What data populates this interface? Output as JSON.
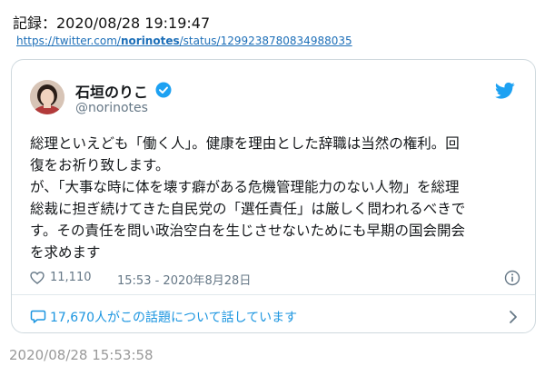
{
  "record": {
    "label": "記録：2020/08/28 19:19:47",
    "link_prefix": "https://twitter.com/",
    "link_user": "norinotes",
    "link_suffix": "/status/1299238780834988035"
  },
  "tweet": {
    "author_name": "石垣のりこ",
    "author_handle": "@norinotes",
    "lines": [
      "総理といえども「働く人」。健康を理由とした辞職は当然の権利。回",
      "復をお祈り致します。",
      "が、「大事な時に体を壊す癖がある危機管理能力のない人物」を総理",
      "総裁に担ぎ続けてきた自民党の「選任責任」は厳しく問われるべきで",
      "す。その責任を問い政治空白を生じさせないためにも早期の国会開会",
      "を求めます"
    ],
    "like_count": "11,110",
    "timestamp": "15:53 - 2020年8月28日",
    "conversation_text": "17,670人がこの話題について話しています",
    "icons": {
      "verified": "verified-badge-icon",
      "brand": "twitter-bird-icon",
      "like": "heart-icon",
      "info": "info-icon",
      "reply": "speech-bubble-icon",
      "more": "chevron-right-icon"
    },
    "colors": {
      "accent": "#1da1f2",
      "link": "#1b95e0",
      "muted": "#657786",
      "border": "#cfd9de"
    }
  },
  "capture_time": "2020/08/28 15:53:58"
}
